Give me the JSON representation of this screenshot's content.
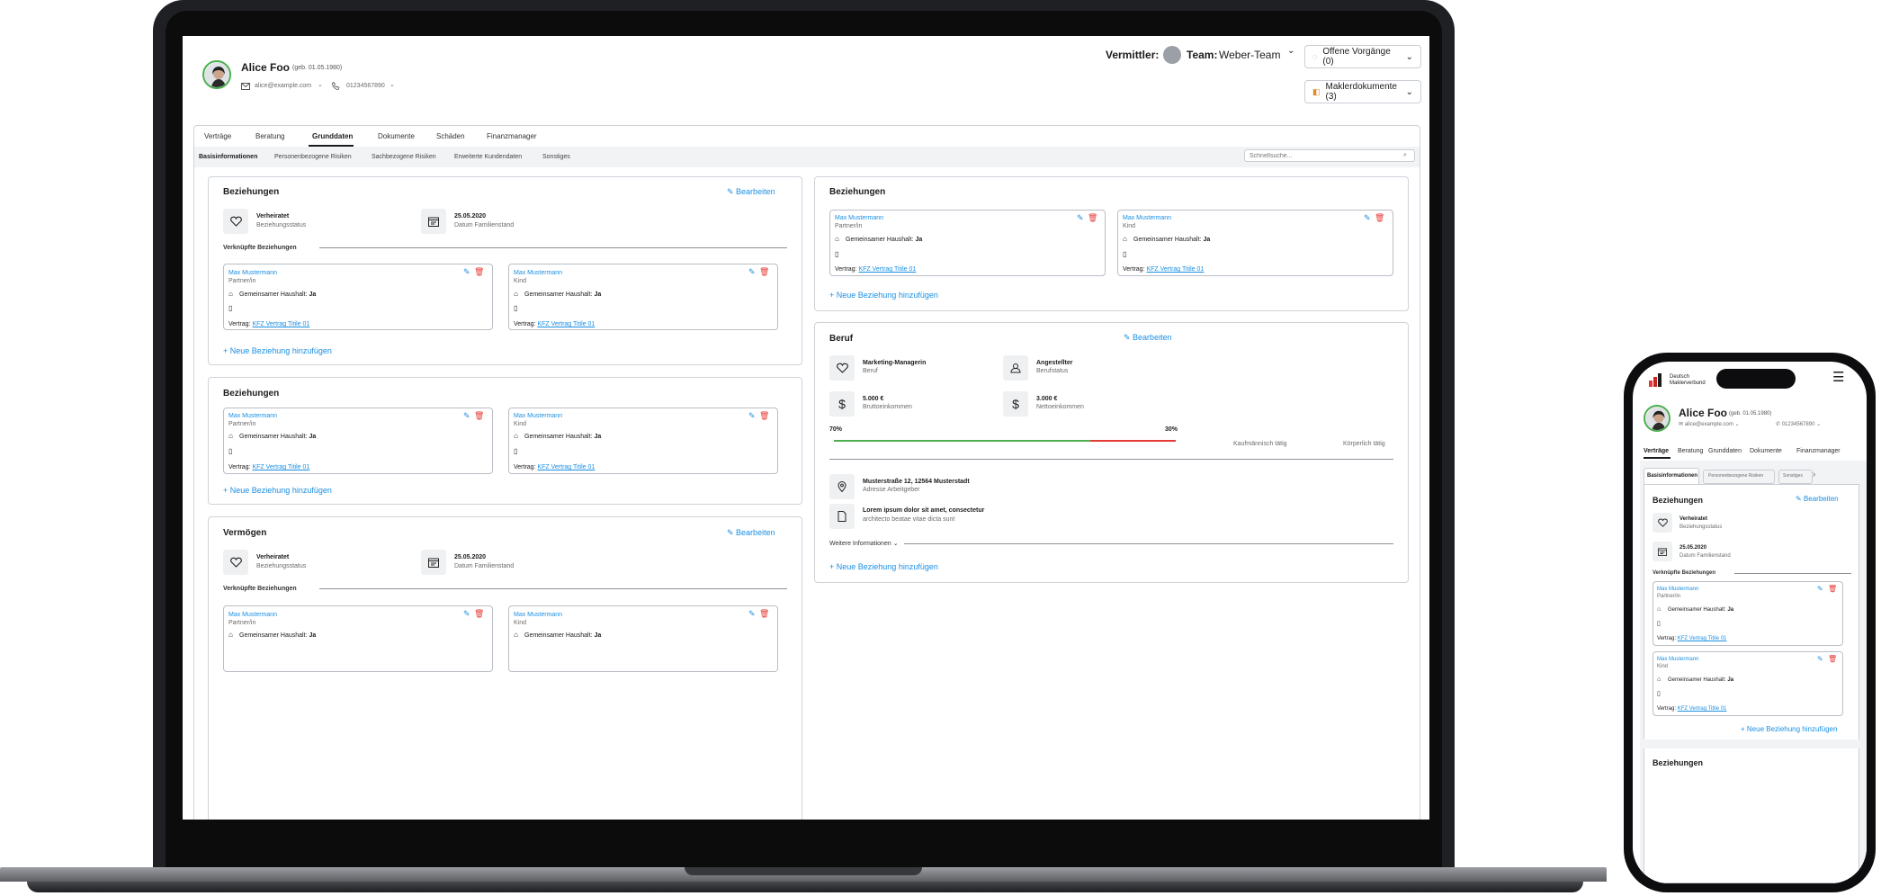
{
  "customer": {
    "name": "Alice Foo",
    "birth": "(geb. 01.05.1980)",
    "email": "alice@example.com",
    "phone": "01234567890"
  },
  "header": {
    "vermittler_label": "Vermittler:",
    "team_label": "Team:",
    "team_value": "Weber-Team",
    "offene_vorgaenge": "Offene Vorgänge (0)",
    "maklerdokumente": "Maklerdokumente (3)"
  },
  "tabs": [
    "Verträge",
    "Beratung",
    "Grunddaten",
    "Dokumente",
    "Schäden",
    "Finanzmanager"
  ],
  "subtabs": [
    "Basisinformationen",
    "Personenbezogene Risiken",
    "Sachbezogene Risiken",
    "Erweiterte Kundendaten",
    "Sonstiges"
  ],
  "search_placeholder": "Schnellsuche...",
  "common": {
    "edit": "Bearbeiten",
    "add_relation": "Neue Beziehung hinzufügen",
    "linked": "Verknüpfte Beziehungen",
    "household": "Gemeinsamer Haushalt:",
    "household_value": "Ja",
    "contract_label": "Vertrag:",
    "contract_link": "KFZ Vertrag Titile 01",
    "person_name": "Max Mustermann",
    "role_partner": "Partner/in",
    "role_kind": "Kind",
    "status_value": "Verheiratet",
    "status_label": "Beziehungsstatus",
    "date_value": "25.05.2020",
    "date_label": "Datum Familienstand"
  },
  "sections": {
    "beziehungen": "Beziehungen",
    "vermoegen": "Vermögen",
    "beruf": "Beruf"
  },
  "beruf": {
    "job": "Marketing-Managerin",
    "job_label": "Beruf",
    "status": "Angestellter",
    "status_label": "Berufstatus",
    "brutto": "5.000 €",
    "brutto_label": "Bruttoeinkommen",
    "netto": "3.000 €",
    "netto_label": "Nettoeinkommen",
    "pct_left": "70%",
    "pct_right": "30%",
    "left_fraction": 0.75,
    "label_left": "Kaufmännisch tätig",
    "label_right": "Körperlich tätig",
    "address": "Musterstraße 12, 12564 Musterstadt",
    "address_label": "Adresse Arbeitgeber",
    "lorem": "Lorem ipsum dolor sit amet, consectetur",
    "lorem_sub": "architecto beatae vitae dicta sunt",
    "more": "Weitere Informationen"
  },
  "mobile": {
    "logo_line1": "Deutsch",
    "logo_line2": "Maklerverbund",
    "tabs": [
      "Verträge",
      "Beratung",
      "Grunddaten",
      "Dokumente",
      "Finanzmanager"
    ],
    "subtabs": [
      "Basisinformationen",
      "Personenbezogene Risiken",
      "Sonstiges"
    ]
  },
  "colors": {
    "accent": "#1a8fe3",
    "danger": "#e53935",
    "success": "#4caf50"
  }
}
